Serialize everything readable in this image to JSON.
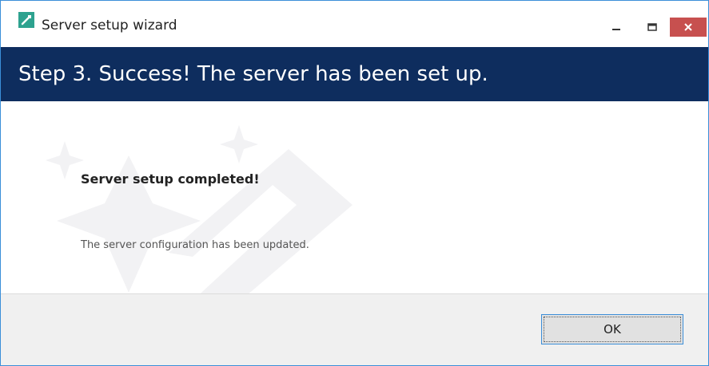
{
  "window": {
    "title": "Server setup wizard",
    "icon": "wizard-app-icon"
  },
  "controls": {
    "minimize_icon": "minimize-icon",
    "maximize_icon": "maximize-icon",
    "close_icon": "close-icon"
  },
  "header": {
    "title": "Step 3. Success! The server has been set up.",
    "background": "#0e2d5e"
  },
  "content": {
    "heading": "Server setup completed!",
    "description": "The server configuration has been updated."
  },
  "footer": {
    "ok_label": "OK"
  },
  "colors": {
    "accent": "#3c8ed8",
    "close_button": "#c7504f"
  }
}
